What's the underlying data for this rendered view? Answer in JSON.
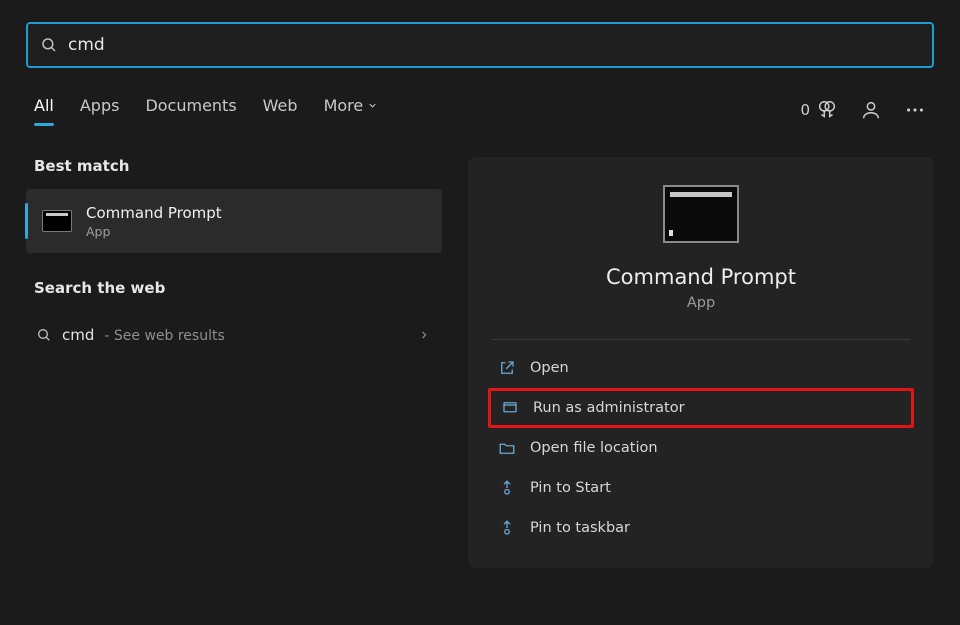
{
  "search": {
    "value": "cmd"
  },
  "tabs": {
    "all": "All",
    "apps": "Apps",
    "documents": "Documents",
    "web": "Web",
    "more": "More"
  },
  "rewards": {
    "count": "0"
  },
  "left": {
    "best_match_header": "Best match",
    "best_match": {
      "title": "Command Prompt",
      "subtitle": "App"
    },
    "search_web_header": "Search the web",
    "web_item": {
      "query": "cmd",
      "desc": "- See web results"
    }
  },
  "detail": {
    "title": "Command Prompt",
    "subtitle": "App",
    "actions": {
      "open": "Open",
      "run_admin": "Run as administrator",
      "open_location": "Open file location",
      "pin_start": "Pin to Start",
      "pin_taskbar": "Pin to taskbar"
    }
  }
}
